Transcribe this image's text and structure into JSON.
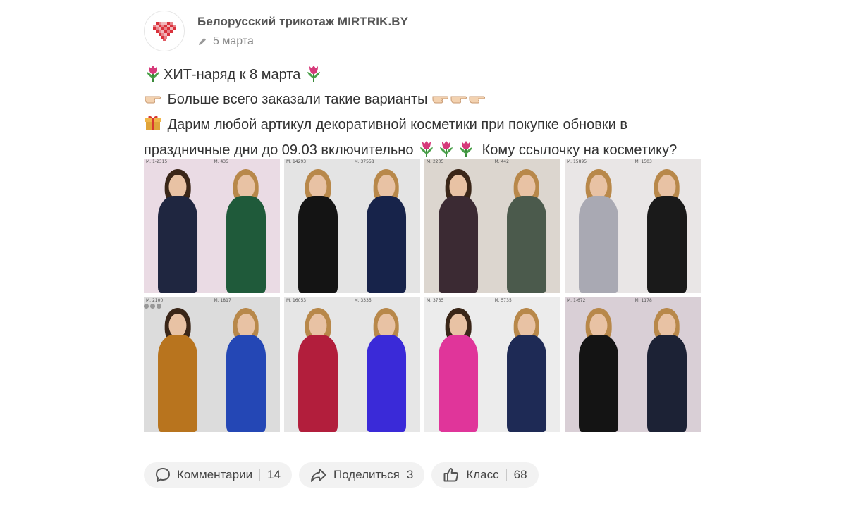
{
  "post": {
    "author": "Белорусский трикотаж MIRTRIK.BY",
    "date": "5 марта",
    "lines": {
      "l1": "ХИТ-наряд к 8 марта",
      "l2": "Больше всего заказали такие варианты",
      "l3": "Дарим любой артикул декоративной косметики при покупке обновки в",
      "l4a": "праздничные дни до 09.03 включительно",
      "l4b": "Кому ссылочку на косметику?"
    }
  },
  "photos": [
    {
      "left_article": "М. 1-2315",
      "right_article": "М. 435",
      "left_dress": "#1f2640",
      "right_dress": "#1f5a3a",
      "bg": "#eadbe4"
    },
    {
      "left_article": "М. 14293",
      "right_article": "М. 37558",
      "left_dress": "#141414",
      "right_dress": "#17234a",
      "bg": "#e4e4e4"
    },
    {
      "left_article": "М. 2205",
      "right_article": "М. 442",
      "left_dress": "#3b2a33",
      "right_dress": "#4b5a4c",
      "bg": "#dcd6cf"
    },
    {
      "left_article": "М. 15895",
      "right_article": "М. 1503",
      "left_dress": "#a9a9b3",
      "right_dress": "#1a1a1a",
      "bg": "#e9e6e6"
    },
    {
      "left_article": "М. 2100",
      "right_article": "М. 1817",
      "left_dress": "#b8741e",
      "right_dress": "#2447b5",
      "bg": "#dcdcdc"
    },
    {
      "left_article": "М. 16053",
      "right_article": "М. 3335",
      "left_dress": "#b21e3c",
      "right_dress": "#3a2ad8",
      "bg": "#e6e6e6"
    },
    {
      "left_article": "М. 3735",
      "right_article": "М. 5735",
      "left_dress": "#e0359a",
      "right_dress": "#1e2a55",
      "bg": "#ececec"
    },
    {
      "left_article": "М. 1-672",
      "right_article": "М. 1178",
      "left_dress": "#141414",
      "right_dress": "#1c2235",
      "bg": "#d9cfd6"
    }
  ],
  "actions": {
    "comments": {
      "label": "Комментарии",
      "count": "14"
    },
    "share": {
      "label": "Поделиться",
      "count": "3"
    },
    "like": {
      "label": "Класс",
      "count": "68"
    }
  },
  "icons": {
    "avatar": "heart-logo-icon",
    "date": "pencil-icon",
    "emoji_tulip": "tulip-icon",
    "emoji_hand": "pointing-hand-icon",
    "emoji_gift": "gift-icon",
    "more": "more-dots-icon",
    "comments": "comment-icon",
    "share": "share-icon",
    "like": "thumbs-up-icon"
  },
  "colors": {
    "accent_heart": "#d9323c",
    "pill_bg": "#f2f2f2",
    "text": "#333333"
  }
}
